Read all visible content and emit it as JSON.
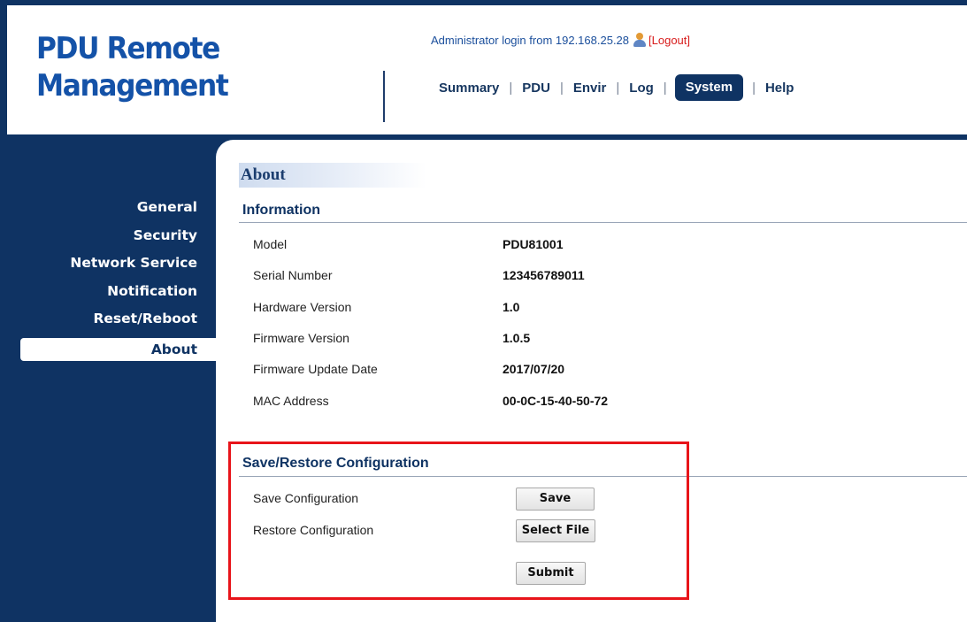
{
  "app": {
    "logo_line1": "PDU Remote",
    "logo_line2": "Management"
  },
  "header": {
    "login_text": "Administrator login from 192.168.25.28",
    "user_icon": "user-icon",
    "logout_label": "[Logout]",
    "nav": {
      "summary": "Summary",
      "pdu": "PDU",
      "envir": "Envir",
      "log": "Log",
      "system": "System",
      "help": "Help",
      "separator": "|"
    }
  },
  "sidebar": {
    "items": [
      {
        "label": "General"
      },
      {
        "label": "Security"
      },
      {
        "label": "Network Service"
      },
      {
        "label": "Notification"
      },
      {
        "label": "Reset/Reboot"
      },
      {
        "label": "About",
        "active": true
      }
    ]
  },
  "main": {
    "title": "About",
    "information": {
      "heading": "Information",
      "rows": [
        {
          "label": "Model",
          "value": "PDU81001"
        },
        {
          "label": "Serial Number",
          "value": "123456789011"
        },
        {
          "label": "Hardware Version",
          "value": "1.0"
        },
        {
          "label": "Firmware Version",
          "value": "1.0.5"
        },
        {
          "label": "Firmware Update Date",
          "value": "2017/07/20"
        },
        {
          "label": "MAC Address",
          "value": "00-0C-15-40-50-72"
        }
      ]
    },
    "config": {
      "heading": "Save/Restore Configuration",
      "save_label": "Save Configuration",
      "save_button": "Save",
      "restore_label": "Restore Configuration",
      "select_file_button": "Select File",
      "submit_button": "Submit"
    }
  },
  "colors": {
    "navy": "#0f3363",
    "logo_blue": "#1452a8",
    "logout_red": "#d81d1d",
    "highlight_red": "#e8141a"
  }
}
